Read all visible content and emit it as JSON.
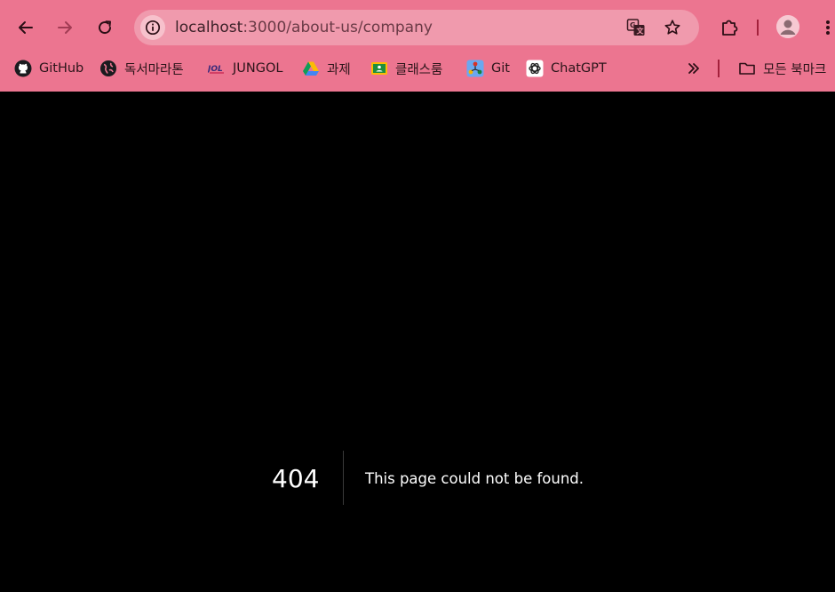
{
  "browser": {
    "url_host": "localhost",
    "url_rest": ":3000/about-us/company",
    "accent_color": "#ec7590",
    "omnibox_color": "#f09aad"
  },
  "toolbar": {
    "back_icon": "back-arrow-icon",
    "forward_icon": "forward-arrow-icon",
    "reload_icon": "reload-icon",
    "site_info_icon": "info-icon",
    "translate_icon": "translate-icon",
    "bookmark_star_icon": "star-icon",
    "extensions_icon": "puzzle-icon",
    "profile_icon": "avatar-icon",
    "menu_icon": "kebab-menu-icon"
  },
  "bookmarks": {
    "items": [
      {
        "label": "GitHub",
        "icon": "github-icon"
      },
      {
        "label": "독서마라톤",
        "icon": "globe-icon"
      },
      {
        "label": "JUNGOL",
        "icon": "jungol-icon"
      },
      {
        "label": "과제",
        "icon": "google-drive-icon"
      },
      {
        "label": "클래스룸",
        "icon": "google-classroom-icon"
      },
      {
        "label": "Git",
        "icon": "git-icon"
      },
      {
        "label": "ChatGPT",
        "icon": "chatgpt-icon"
      }
    ],
    "overflow_icon": "chevron-double-right-icon",
    "all_bookmarks_label": "모든 북마크",
    "all_bookmarks_icon": "folder-icon"
  },
  "page": {
    "status_code": "404",
    "message": "This page could not be found."
  }
}
